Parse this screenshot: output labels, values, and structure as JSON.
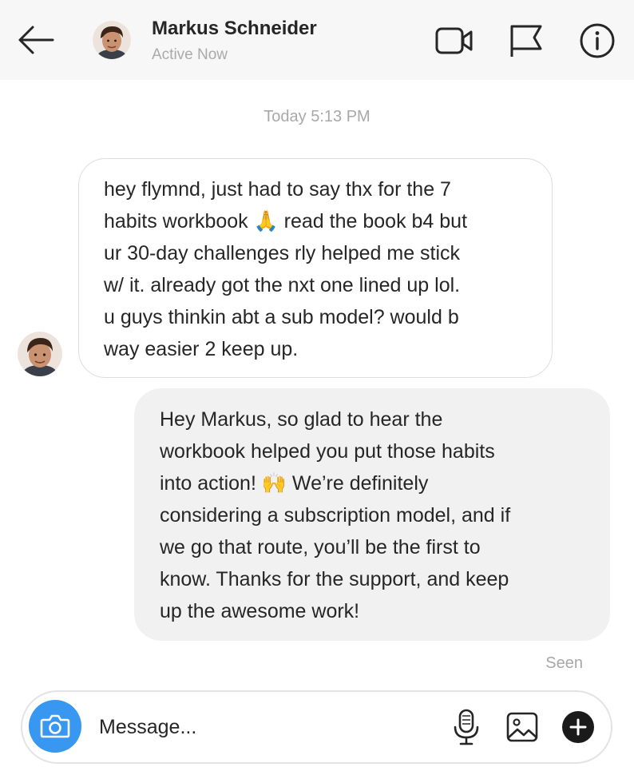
{
  "header": {
    "name": "Markus Schneider",
    "status": "Active Now",
    "icons": [
      "back-arrow-icon",
      "video-camera-icon",
      "flag-icon",
      "info-icon"
    ]
  },
  "conversation": {
    "timestamp": "Today 5:13 PM",
    "messages": [
      {
        "direction": "incoming",
        "text": "hey flymnd, just had to say thx for the 7\nhabits workbook 🙏 read the book b4 but\nur 30-day challenges rly helped me stick\nw/ it. already got the nxt one lined up lol.\nu guys thinkin abt a sub model? would b\nway easier 2 keep up."
      },
      {
        "direction": "outgoing",
        "text": "Hey Markus, so glad to hear the\nworkbook helped you put those habits\ninto action! 🙌 We’re definitely\nconsidering a subscription model, and if\nwe go that route, you’ll be the first to\nknow. Thanks for the support, and keep\nup the awesome work!"
      }
    ],
    "seen_label": "Seen"
  },
  "composer": {
    "placeholder": "Message...",
    "icons": [
      "camera-icon",
      "microphone-icon",
      "image-icon",
      "add-icon"
    ]
  },
  "colors": {
    "accent": "#3897f0",
    "header_bg": "#f7f7f7",
    "outgoing_bubble": "#f1f1f1"
  }
}
